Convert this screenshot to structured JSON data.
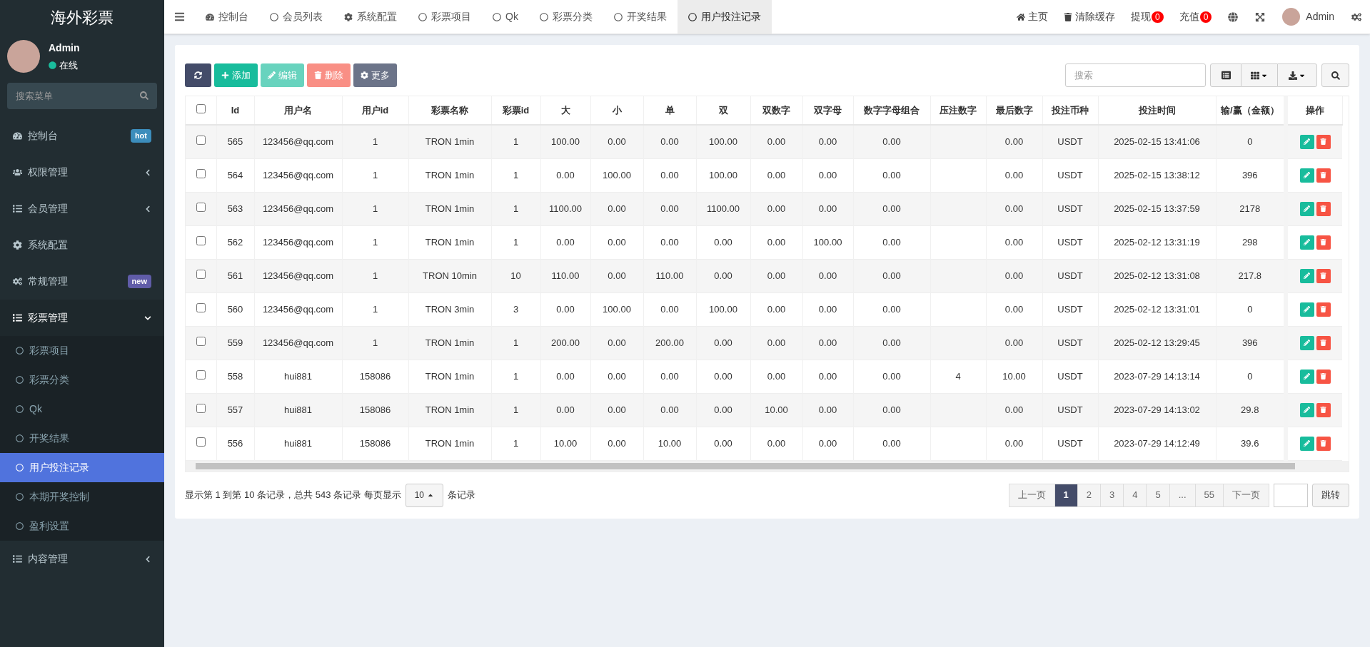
{
  "brand": "海外彩票",
  "user": {
    "name": "Admin",
    "status": "在线",
    "online": true
  },
  "sidebar": {
    "search_placeholder": "搜索菜单",
    "items": [
      {
        "label": "控制台",
        "badge": {
          "text": "hot",
          "color": "#3c8dbc"
        }
      },
      {
        "label": "权限管理",
        "expanded": false
      },
      {
        "label": "会员管理",
        "expanded": false
      },
      {
        "label": "系统配置"
      },
      {
        "label": "常规管理",
        "badge": {
          "text": "new",
          "color": "#605ca8"
        }
      },
      {
        "label": "彩票管理",
        "expanded": true,
        "children": [
          {
            "label": "彩票项目",
            "selected": false
          },
          {
            "label": "彩票分类",
            "selected": false
          },
          {
            "label": "Qk",
            "selected": false
          },
          {
            "label": "开奖结果",
            "selected": false
          },
          {
            "label": "用户投注记录",
            "selected": true
          },
          {
            "label": "本期开奖控制",
            "selected": false
          },
          {
            "label": "盈利设置",
            "selected": false
          }
        ]
      },
      {
        "label": "内容管理",
        "expanded": false
      }
    ]
  },
  "tabs": [
    {
      "label": "控制台",
      "selected": false
    },
    {
      "label": "会员列表",
      "selected": false
    },
    {
      "label": "系统配置",
      "selected": false
    },
    {
      "label": "彩票项目",
      "selected": false
    },
    {
      "label": "Qk",
      "selected": false
    },
    {
      "label": "彩票分类",
      "selected": false
    },
    {
      "label": "开奖结果",
      "selected": false
    },
    {
      "label": "用户投注记录",
      "selected": true
    }
  ],
  "topbar_right": [
    {
      "kind": "home",
      "label": "主页"
    },
    {
      "kind": "clear_cache",
      "label": "清除缓存"
    },
    {
      "kind": "badge",
      "label": "提现",
      "count": "0"
    },
    {
      "kind": "badge",
      "label": "充值",
      "count": "0"
    },
    {
      "kind": "language"
    },
    {
      "kind": "fullscreen"
    },
    {
      "kind": "user",
      "label": "Admin"
    },
    {
      "kind": "settings"
    }
  ],
  "toolbar": [
    {
      "kind": "refresh",
      "disabled": false
    },
    {
      "kind": "add",
      "label": "添加",
      "disabled": false
    },
    {
      "kind": "edit",
      "label": "编辑",
      "disabled": true
    },
    {
      "kind": "delete",
      "label": "删除",
      "disabled": true
    },
    {
      "kind": "more",
      "label": "更多",
      "disabled": false
    }
  ],
  "table_search": {
    "placeholder": "搜索"
  },
  "table": {
    "select_all_checked": false,
    "columns": [
      "Id",
      "用户名",
      "用户id",
      "彩票名称",
      "彩票id",
      "大",
      "小",
      "单",
      "双",
      "双数字",
      "双字母",
      "数字字母组合",
      "压注数字",
      "最后数字",
      "投注币种",
      "投注时间",
      "输/赢（金额）",
      "操作"
    ],
    "rows": [
      {
        "checked": false,
        "cells": [
          "565",
          "123456@qq.com",
          "1",
          "TRON 1min",
          "1",
          "100.00",
          "0.00",
          "0.00",
          "100.00",
          "0.00",
          "0.00",
          "0.00",
          null,
          "0.00",
          "USDT",
          "2025-02-15 13:41:06",
          "0"
        ]
      },
      {
        "checked": false,
        "cells": [
          "564",
          "123456@qq.com",
          "1",
          "TRON 1min",
          "1",
          "0.00",
          "100.00",
          "0.00",
          "100.00",
          "0.00",
          "0.00",
          "0.00",
          null,
          "0.00",
          "USDT",
          "2025-02-15 13:38:12",
          "396"
        ]
      },
      {
        "checked": false,
        "cells": [
          "563",
          "123456@qq.com",
          "1",
          "TRON 1min",
          "1",
          "1100.00",
          "0.00",
          "0.00",
          "1100.00",
          "0.00",
          "0.00",
          "0.00",
          null,
          "0.00",
          "USDT",
          "2025-02-15 13:37:59",
          "2178"
        ]
      },
      {
        "checked": false,
        "cells": [
          "562",
          "123456@qq.com",
          "1",
          "TRON 1min",
          "1",
          "0.00",
          "0.00",
          "0.00",
          "0.00",
          "0.00",
          "100.00",
          "0.00",
          null,
          "0.00",
          "USDT",
          "2025-02-12 13:31:19",
          "298"
        ]
      },
      {
        "checked": false,
        "cells": [
          "561",
          "123456@qq.com",
          "1",
          "TRON 10min",
          "10",
          "110.00",
          "0.00",
          "110.00",
          "0.00",
          "0.00",
          "0.00",
          "0.00",
          null,
          "0.00",
          "USDT",
          "2025-02-12 13:31:08",
          "217.8"
        ]
      },
      {
        "checked": false,
        "cells": [
          "560",
          "123456@qq.com",
          "1",
          "TRON 3min",
          "3",
          "0.00",
          "100.00",
          "0.00",
          "100.00",
          "0.00",
          "0.00",
          "0.00",
          null,
          "0.00",
          "USDT",
          "2025-02-12 13:31:01",
          "0"
        ]
      },
      {
        "checked": false,
        "cells": [
          "559",
          "123456@qq.com",
          "1",
          "TRON 1min",
          "1",
          "200.00",
          "0.00",
          "200.00",
          "0.00",
          "0.00",
          "0.00",
          "0.00",
          null,
          "0.00",
          "USDT",
          "2025-02-12 13:29:45",
          "396"
        ]
      },
      {
        "checked": false,
        "cells": [
          "558",
          "hui881",
          "158086",
          "TRON 1min",
          "1",
          "0.00",
          "0.00",
          "0.00",
          "0.00",
          "0.00",
          "0.00",
          "0.00",
          "4",
          "10.00",
          "USDT",
          "2023-07-29 14:13:14",
          "0"
        ]
      },
      {
        "checked": false,
        "cells": [
          "557",
          "hui881",
          "158086",
          "TRON 1min",
          "1",
          "0.00",
          "0.00",
          "0.00",
          "0.00",
          "10.00",
          "0.00",
          "0.00",
          null,
          "0.00",
          "USDT",
          "2023-07-29 14:13:02",
          "29.8"
        ]
      },
      {
        "checked": false,
        "cells": [
          "556",
          "hui881",
          "158086",
          "TRON 1min",
          "1",
          "10.00",
          "0.00",
          "10.00",
          "0.00",
          "0.00",
          "0.00",
          "0.00",
          null,
          "0.00",
          "USDT",
          "2023-07-29 14:12:49",
          "39.6"
        ]
      }
    ]
  },
  "pagination": {
    "summary": "显示第 1 到第 10 条记录，总共 543 条记录 每页显示",
    "page_size": "10",
    "suffix": "条记录",
    "pages": [
      {
        "label": "上一页",
        "selected": false
      },
      {
        "label": "1",
        "selected": true
      },
      {
        "label": "2",
        "selected": false
      },
      {
        "label": "3",
        "selected": false
      },
      {
        "label": "4",
        "selected": false
      },
      {
        "label": "5",
        "selected": false
      },
      {
        "label": "...",
        "selected": false
      },
      {
        "label": "55",
        "selected": false
      },
      {
        "label": "下一页",
        "selected": false
      }
    ],
    "jump_label": "跳转"
  }
}
